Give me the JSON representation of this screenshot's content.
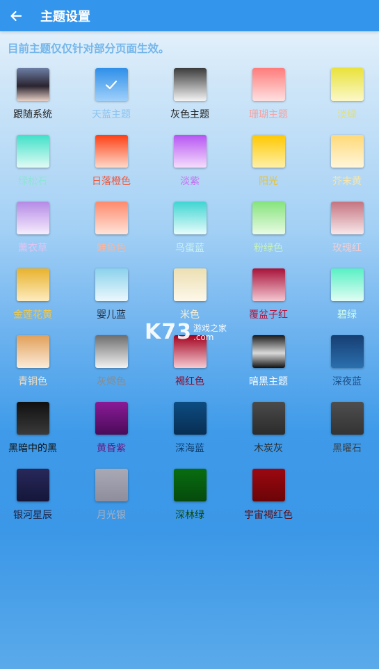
{
  "app_bar": {
    "title": "主题设置",
    "back_icon": "arrow-left-icon"
  },
  "notice": "目前主题仅仅针对部分页面生效。",
  "watermark": {
    "logo": "K73",
    "site_name": "游戏之家",
    "domain": ".com"
  },
  "themes": [
    {
      "label": "跟随系统",
      "label_color": "#222222",
      "top": "#6c7ea4",
      "bottom": "#e6cfc4",
      "mid": "#2a2430",
      "selected": false
    },
    {
      "label": "天蓝主题",
      "label_color": "#8cc3f0",
      "top": "#2f8fe8",
      "bottom": "#9fd0fb",
      "selected": true
    },
    {
      "label": "灰色主题",
      "label_color": "#222222",
      "top": "#3c3c3c",
      "bottom": "#f4f4f4",
      "selected": false
    },
    {
      "label": "珊瑚主题",
      "label_color": "#f4a3a3",
      "top": "#ff7c7c",
      "bottom": "#ffe0e0",
      "selected": false
    },
    {
      "label": "淡绿",
      "label_color": "#e3e06c",
      "top": "#e9e23c",
      "bottom": "#fbf8c9",
      "selected": false
    },
    {
      "label": "绿松石",
      "label_color": "#8fe3d6",
      "top": "#40e0c8",
      "bottom": "#e1fbf5",
      "selected": false
    },
    {
      "label": "日落橙色",
      "label_color": "#f1563b",
      "top": "#ff3f14",
      "bottom": "#ffd9c9",
      "selected": false
    },
    {
      "label": "淡紫",
      "label_color": "#c66df0",
      "top": "#b555f2",
      "bottom": "#f5dcfc",
      "selected": false
    },
    {
      "label": "阳光",
      "label_color": "#e8c030",
      "top": "#ffc800",
      "bottom": "#fff0a8",
      "selected": false
    },
    {
      "label": "芥末黄",
      "label_color": "#f7e6a8",
      "top": "#ffd976",
      "bottom": "#fff6dc",
      "selected": false
    },
    {
      "label": "薰衣草",
      "label_color": "#e0c5f2",
      "top": "#b58ae6",
      "bottom": "#f6edfc",
      "selected": false
    },
    {
      "label": "鲑鱼色",
      "label_color": "#f7b6a0",
      "top": "#ff8a6c",
      "bottom": "#ffe4da",
      "selected": false
    },
    {
      "label": "鸟蛋蓝",
      "label_color": "#c8f2ef",
      "top": "#3fd5d2",
      "bottom": "#e8fcfb",
      "selected": false
    },
    {
      "label": "粉绿色",
      "label_color": "#c5f1bd",
      "top": "#86e47c",
      "bottom": "#e9fbe4",
      "selected": false
    },
    {
      "label": "玫瑰红",
      "label_color": "#f1cdd2",
      "top": "#c47480",
      "bottom": "#f8e8ea",
      "selected": false
    },
    {
      "label": "金莲花黄",
      "label_color": "#f0c84a",
      "top": "#e8b22c",
      "bottom": "#fdecc0",
      "selected": false
    },
    {
      "label": "婴儿蓝",
      "label_color": "#1e2a3a",
      "top": "#8ad2ec",
      "bottom": "#ecf8fd",
      "selected": false
    },
    {
      "label": "米色",
      "label_color": "#f7efd6",
      "top": "#ecdfb2",
      "bottom": "#fdf8ea",
      "selected": false
    },
    {
      "label": "覆盆子红",
      "label_color": "#b8163c",
      "top": "#a8123a",
      "bottom": "#f4c7d1",
      "selected": false
    },
    {
      "label": "碧绿",
      "label_color": "#cdfcec",
      "top": "#58f0c4",
      "bottom": "#e2fdf4",
      "selected": false
    },
    {
      "label": "青铜色",
      "label_color": "#f0dcc0",
      "top": "#e1a05a",
      "bottom": "#fbecd8",
      "selected": false
    },
    {
      "label": "灰烬色",
      "label_color": "#8b8b8b",
      "top": "#6e6e6e",
      "bottom": "#f2f2f2",
      "selected": false
    },
    {
      "label": "褐红色",
      "label_color": "#8c0a2c",
      "top": "#a3001e",
      "bottom": "#f5cad2",
      "selected": false
    },
    {
      "label": "暗黑主题",
      "label_color": "#fefefe",
      "top": "#1a1a1a",
      "bottom": "#121212",
      "mid": "#d9d9d9",
      "selected": false
    },
    {
      "label": "深夜蓝",
      "label_color": "#1f4e86",
      "top": "#163e72",
      "bottom": "#2b6fae",
      "selected": false
    },
    {
      "label": "黑暗中的黑",
      "label_color": "#111111",
      "top": "#101010",
      "bottom": "#3a3a3a",
      "selected": false
    },
    {
      "label": "黄昏紫",
      "label_color": "#6c1882",
      "top": "#8a1a96",
      "bottom": "#4a0b5a",
      "selected": false
    },
    {
      "label": "深海蓝",
      "label_color": "#0e3c6c",
      "top": "#0c4c82",
      "bottom": "#082e52",
      "selected": false
    },
    {
      "label": "木炭灰",
      "label_color": "#2c2c2c",
      "top": "#4a4a4a",
      "bottom": "#2b2b2b",
      "selected": false
    },
    {
      "label": "黑曜石",
      "label_color": "#3c4248",
      "top": "#4e4e4e",
      "bottom": "#333333",
      "selected": false
    },
    {
      "label": "银河星辰",
      "label_color": "#1e2040",
      "top": "#28285a",
      "bottom": "#15163a",
      "selected": false
    },
    {
      "label": "月光银",
      "label_color": "#a8b0c0",
      "top": "#a9a9b6",
      "bottom": "#8d8d9c",
      "selected": false
    },
    {
      "label": "深林绿",
      "label_color": "#0a4a12",
      "top": "#086d10",
      "bottom": "#064a0c",
      "selected": false
    },
    {
      "label": "宇宙褐红色",
      "label_color": "#5a0a12",
      "top": "#9c0810",
      "bottom": "#6a0508",
      "selected": false
    }
  ]
}
